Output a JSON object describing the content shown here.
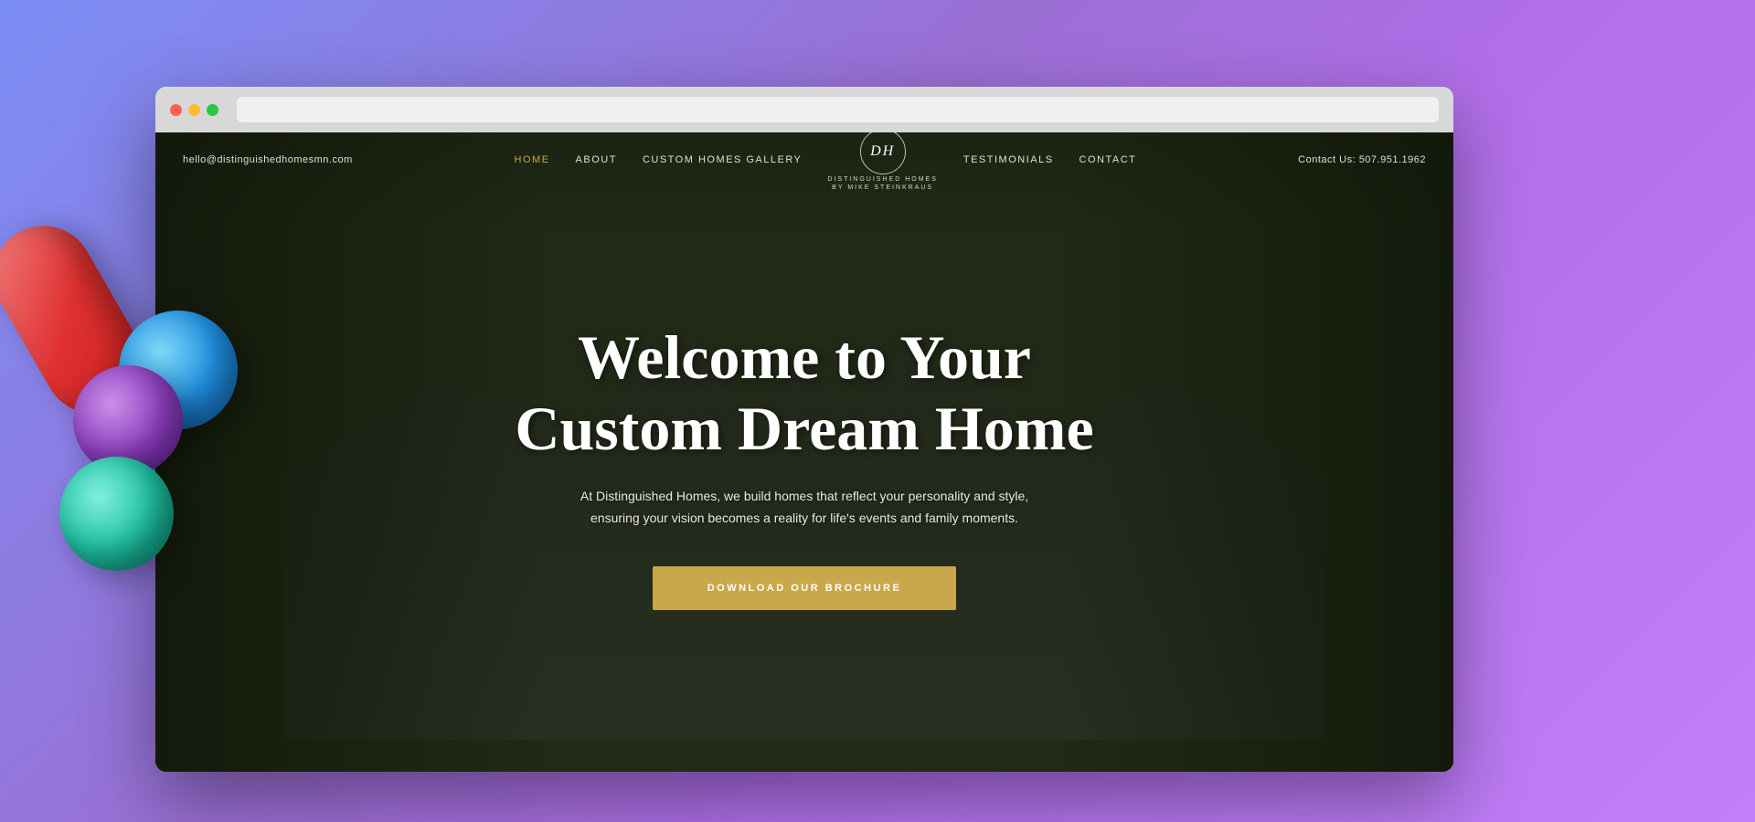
{
  "background": {
    "gradient_start": "#7b8ef5",
    "gradient_end": "#b06ee8"
  },
  "browser": {
    "dots": [
      "#ff5f57",
      "#febc2e",
      "#28c840"
    ]
  },
  "nav": {
    "email": "hello@distinguishedhomesmn.com",
    "items": [
      {
        "label": "HOME",
        "active": true
      },
      {
        "label": "ABOUT",
        "active": false
      },
      {
        "label": "CUSTOM HOMES GALLERY",
        "active": false
      },
      {
        "label": "TESTIMONIALS",
        "active": false
      },
      {
        "label": "CONTACT",
        "active": false
      }
    ],
    "logo_text": "DH",
    "logo_subtext": "DISTINGUISHED HOMES",
    "logo_byline": "BY MIKE STEINKRAUS",
    "phone": "Contact Us: 507.951.1962"
  },
  "hero": {
    "title_line1": "Welcome to Your",
    "title_line2": "Custom Dream Home",
    "subtitle": "At Distinguished Homes, we build homes that reflect your personality and style, ensuring your vision becomes a reality for life's events and family moments.",
    "cta_label": "DOWNLOAD OUR BROCHURE"
  }
}
